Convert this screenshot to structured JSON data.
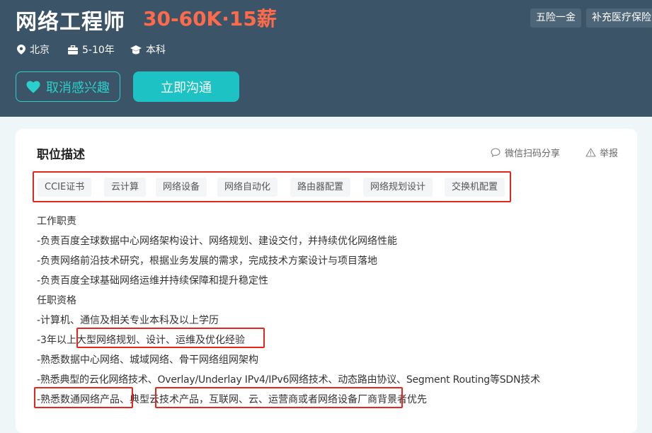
{
  "job": {
    "title": "网络工程师",
    "salary": "30-60K·15薪",
    "benefits": [
      "五险一金",
      "补充医疗保险"
    ],
    "location": "北京",
    "experience": "5-10年",
    "education": "本科",
    "icons": [
      "location-pin-icon",
      "briefcase-icon",
      "graduation-cap-icon",
      "heart-icon"
    ]
  },
  "actions": {
    "interest_label": "取消感兴趣",
    "chat_label": "立即沟通"
  },
  "colors": {
    "header_bg": "#3b5468",
    "salary": "#ff6b4a",
    "accent": "#1cc2c4",
    "highlight_box": "#e4261c"
  },
  "description": {
    "section_title": "职位描述",
    "share_label": "微信扫码分享",
    "report_label": "举报",
    "tags": [
      "CCIE证书",
      "云计算",
      "网络设备",
      "网络自动化",
      "路由器配置",
      "网络规划设计",
      "交换机配置"
    ],
    "lines": [
      "工作职责",
      "-负责百度全球数据中心网络架构设计、网络规划、建设交付，并持续优化网络性能",
      "-负责网络前沿技术研究，根据业务发展的需求，完成技术方案设计与项目落地",
      "-负责百度全球基础网络运维并持续保障和提升稳定性",
      "任职资格",
      "-计算机、通信及相关专业本科及以上学历",
      "-3年以上大型网络规划、设计、运维及优化经验",
      "-熟悉数据中心网络、城域网络、骨干网络组网架构",
      "-熟悉典型的云化网络技术、Overlay/Underlay IPv4/IPv6网络技术、动态路由协议、Segment Routing等SDN技术",
      "-熟悉数通网络产品、典型云技术产品，互联网、云、运营商或者网络设备厂商背景者优先"
    ]
  }
}
